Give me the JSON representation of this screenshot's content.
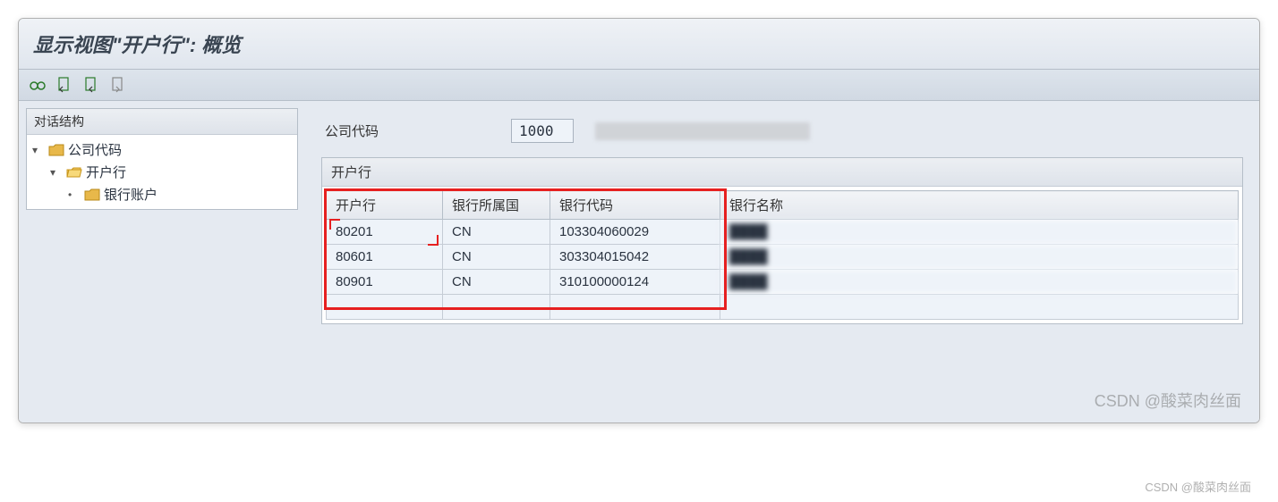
{
  "title": "显示视图\"开户行\": 概览",
  "sidebar": {
    "header": "对话结构",
    "nodes": [
      {
        "label": "公司代码",
        "indent": 0,
        "open": false
      },
      {
        "label": "开户行",
        "indent": 1,
        "open": true
      },
      {
        "label": "银行账户",
        "indent": 2,
        "open": false
      }
    ]
  },
  "form": {
    "company_code_label": "公司代码",
    "company_code_value": "1000"
  },
  "table": {
    "section_title": "开户行",
    "columns": [
      "开户行",
      "银行所属国",
      "银行代码",
      "银行名称"
    ],
    "rows": [
      {
        "bank": "80201",
        "country": "CN",
        "code": "103304060029",
        "name": ""
      },
      {
        "bank": "80601",
        "country": "CN",
        "code": "303304015042",
        "name": ""
      },
      {
        "bank": "80901",
        "country": "CN",
        "code": "310100000124",
        "name": ""
      }
    ]
  },
  "watermark": "CSDN @酸菜肉丝面",
  "outer_watermark": "CSDN @酸菜肉丝面"
}
